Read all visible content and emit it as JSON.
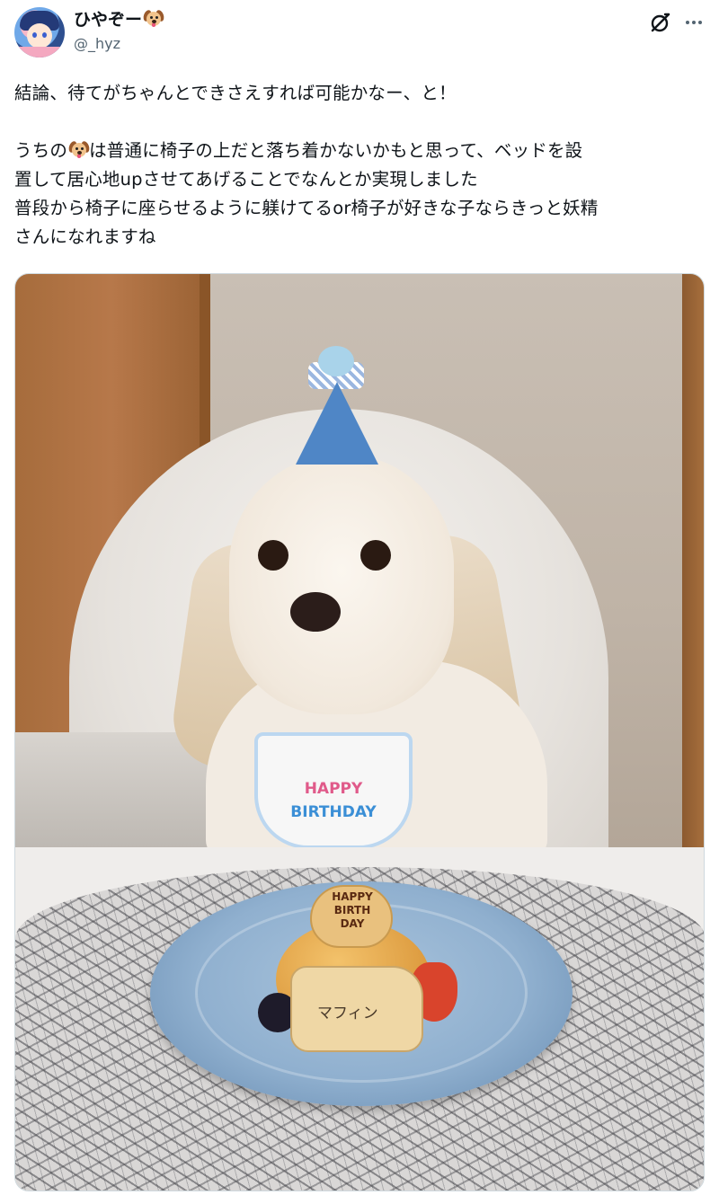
{
  "header": {
    "display_name": "ひやぞー",
    "handle": "@_hyz"
  },
  "tweet": {
    "line1": "結論、待てがちゃんとできさえすれば可能かなー、と！",
    "line2_pre": "うちの",
    "line2_post": "は普通に椅子の上だと落ち着かないかもと思って、ベッドを設",
    "line3": "置して居心地upさせてあげることでなんとか実現しました",
    "line4": "普段から椅子に座らせるように躾けてるor椅子が好きな子ならきっと妖精",
    "line5": "さんになれますね"
  },
  "photo": {
    "bib_line1": "HAPPY",
    "bib_line2": "BIRTHDAY",
    "heart_line1": "HAPPY",
    "heart_line2": "BIRTH",
    "heart_line3": "DAY",
    "cookie_text": "マフィン"
  },
  "icons": {
    "emoji": "dog-face-icon",
    "action_1": "grok-icon",
    "action_2": "more-icon"
  }
}
